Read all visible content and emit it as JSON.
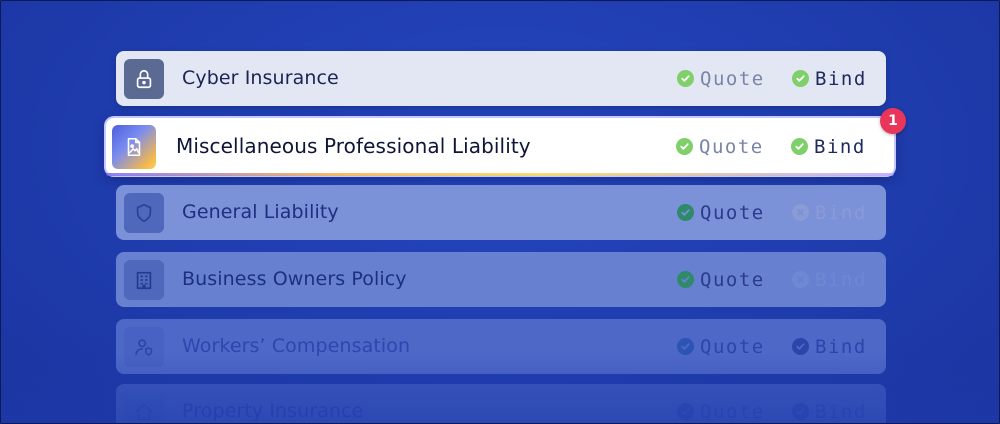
{
  "rows": [
    {
      "name": "Cyber Insurance",
      "quote": "Quote",
      "bind": "Bind"
    },
    {
      "name": "Miscellaneous Professional Liability",
      "quote": "Quote",
      "bind": "Bind",
      "badge": "1"
    },
    {
      "name": "General Liability",
      "quote": "Quote",
      "bind": "Bind"
    },
    {
      "name": "Business Owners Policy",
      "quote": "Quote",
      "bind": "Bind"
    },
    {
      "name": "Workers’ Compensation",
      "quote": "Quote",
      "bind": "Bind"
    },
    {
      "name": "Property Insurance",
      "quote": "Quote",
      "bind": "Bind"
    }
  ],
  "icons": [
    "lock-icon",
    "document-image-icon",
    "shield-icon",
    "building-icon",
    "user-shield-icon",
    "house-icon"
  ],
  "status": {
    "cyber": {
      "quote": "done",
      "bind": "done"
    },
    "misc_professional": {
      "quote": "done",
      "bind": "done"
    },
    "general_liability": {
      "quote": "done",
      "bind": "unavailable"
    },
    "business_owners": {
      "quote": "done",
      "bind": "unavailable"
    },
    "workers_comp": {
      "quote": "done",
      "bind": "done"
    },
    "property": {
      "quote": "done",
      "bind": "done"
    }
  },
  "colors": {
    "background": "#1f3cb0",
    "check_green": "#7fcf6a",
    "badge": "#e8365a"
  }
}
